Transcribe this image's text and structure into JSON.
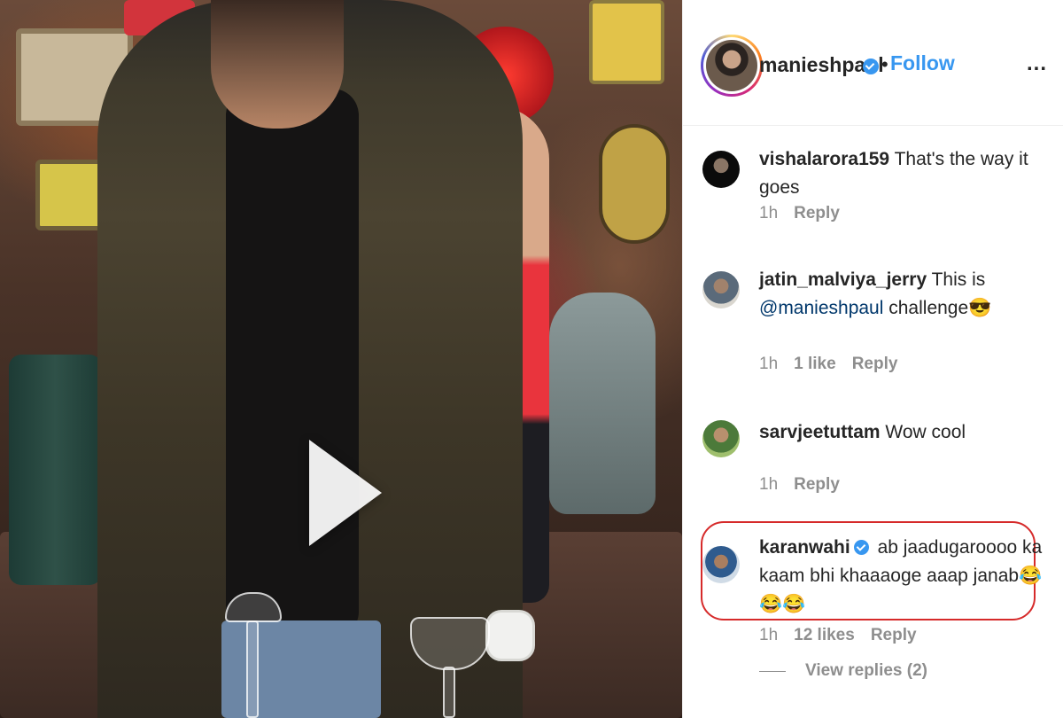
{
  "post": {
    "media_type": "video",
    "play_icon": "play-icon"
  },
  "header": {
    "username": "manieshpaul",
    "verified": true,
    "separator": "•",
    "follow_label": "Follow",
    "more_label": "..."
  },
  "comments": [
    {
      "username": "vishalarora159",
      "text": "That's the way it goes",
      "time": "1h",
      "reply_label": "Reply"
    },
    {
      "username": "jatin_malviya_jerry",
      "text_before": "This is",
      "mention": "@manieshpaul",
      "text_after": "challenge",
      "emoji": "😎",
      "time": "1h",
      "likes": "1 like",
      "reply_label": "Reply"
    },
    {
      "username": "sarvjeetuttam",
      "text": "Wow cool",
      "time": "1h",
      "reply_label": "Reply"
    },
    {
      "username": "karanwahi",
      "verified": true,
      "text": "ab jaadugaroooo ka kaam bhi khaaaoge aaap janab",
      "emoji": "😂😂😂",
      "time": "1h",
      "likes": "12 likes",
      "reply_label": "Reply",
      "highlighted": true,
      "highlight_color": "#d62a2a"
    }
  ],
  "view_replies_label": "View replies (2)",
  "colors": {
    "link": "#3897f0",
    "muted": "#8e8e8e",
    "text": "#262626",
    "mention": "#00376b"
  }
}
